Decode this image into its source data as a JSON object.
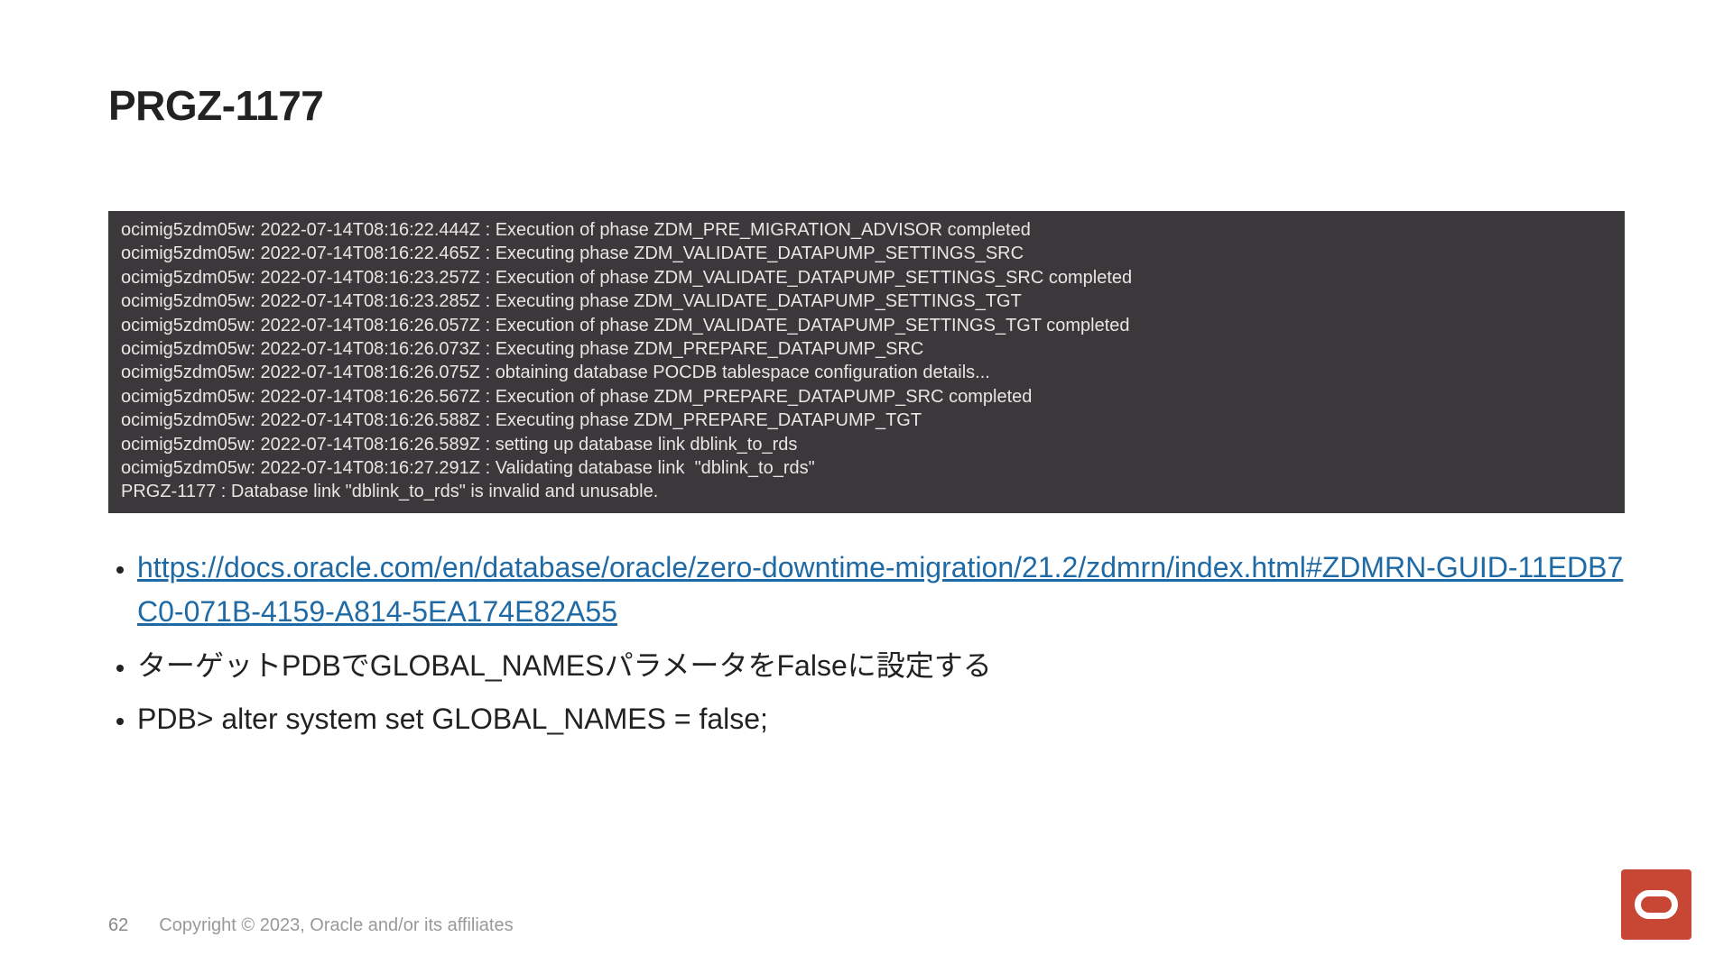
{
  "title": "PRGZ-1177",
  "console_lines": [
    "ocimig5zdm05w: 2022-07-14T08:16:22.444Z : Execution of phase ZDM_PRE_MIGRATION_ADVISOR completed",
    "ocimig5zdm05w: 2022-07-14T08:16:22.465Z : Executing phase ZDM_VALIDATE_DATAPUMP_SETTINGS_SRC",
    "ocimig5zdm05w: 2022-07-14T08:16:23.257Z : Execution of phase ZDM_VALIDATE_DATAPUMP_SETTINGS_SRC completed",
    "ocimig5zdm05w: 2022-07-14T08:16:23.285Z : Executing phase ZDM_VALIDATE_DATAPUMP_SETTINGS_TGT",
    "ocimig5zdm05w: 2022-07-14T08:16:26.057Z : Execution of phase ZDM_VALIDATE_DATAPUMP_SETTINGS_TGT completed",
    "ocimig5zdm05w: 2022-07-14T08:16:26.073Z : Executing phase ZDM_PREPARE_DATAPUMP_SRC",
    "ocimig5zdm05w: 2022-07-14T08:16:26.075Z : obtaining database POCDB tablespace configuration details...",
    "ocimig5zdm05w: 2022-07-14T08:16:26.567Z : Execution of phase ZDM_PREPARE_DATAPUMP_SRC completed",
    "ocimig5zdm05w: 2022-07-14T08:16:26.588Z : Executing phase ZDM_PREPARE_DATAPUMP_TGT",
    "ocimig5zdm05w: 2022-07-14T08:16:26.589Z : setting up database link dblink_to_rds",
    "ocimig5zdm05w: 2022-07-14T08:16:27.291Z : Validating database link  \"dblink_to_rds\"",
    "PRGZ-1177 : Database link \"dblink_to_rds\" is invalid and unusable."
  ],
  "bullets": {
    "link_text": "https://docs.oracle.com/en/database/oracle/zero-downtime-migration/21.2/zdmrn/index.html#ZDMRN-GUID-11EDB7C0-071B-4159-A814-5EA174E82A55",
    "b2": "ターゲットPDBでGLOBAL_NAMESパラメータをFalseに設定する",
    "b3": "PDB> alter system set GLOBAL_NAMES = false;"
  },
  "footer": {
    "page": "62",
    "copyright": "Copyright © 2023, Oracle and/or its affiliates"
  }
}
